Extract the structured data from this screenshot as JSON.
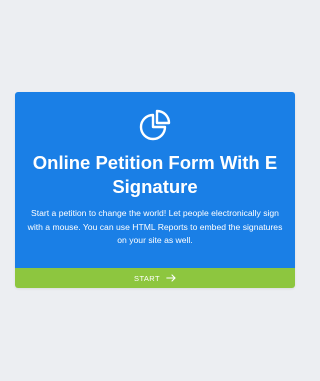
{
  "card": {
    "icon": "pie-chart-icon",
    "title": "Online Petition Form With E Signature",
    "description": "Start a petition to change the world! Let people electronically sign with a mouse. You can use HTML Reports to embed the signatures on your site as well.",
    "start_label": "START",
    "start_icon": "arrow-right-icon"
  },
  "colors": {
    "page_background": "#eceef2",
    "card_blue": "#1a7fe6",
    "start_green": "#8dc63f",
    "text": "#ffffff"
  }
}
